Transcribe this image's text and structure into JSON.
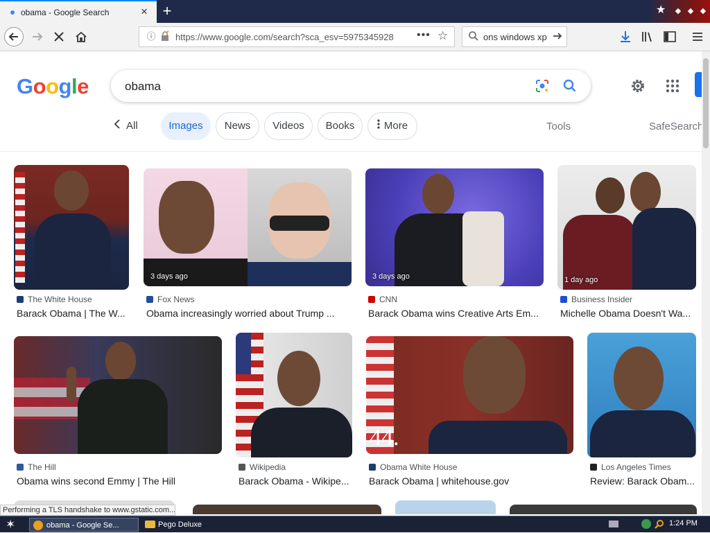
{
  "browser": {
    "tab": {
      "title": "obama - Google Search",
      "close_glyph": "×"
    },
    "new_tab_glyph": "+",
    "url": "https://www.google.com/search?sca_esv=5975345928",
    "url_menu_glyph": "•••",
    "searchbar": {
      "value": "ons windows xp"
    }
  },
  "google": {
    "logo": [
      "G",
      "o",
      "o",
      "g",
      "l",
      "e"
    ],
    "logo_colors": [
      "#4285f4",
      "#ea4335",
      "#fbbc05",
      "#4285f4",
      "#34a853",
      "#ea4335"
    ],
    "query": "obama",
    "chips": {
      "all": "All",
      "images": "Images",
      "news": "News",
      "videos": "Videos",
      "books": "Books",
      "more": "More"
    },
    "tools": "Tools",
    "safesearch": "SafeSearch"
  },
  "results": [
    {
      "source": "The White House",
      "title": "Barack Obama | The W...",
      "age": "",
      "src_color": "#1a3e74"
    },
    {
      "source": "Fox News",
      "title": "Obama increasingly worried about Trump ...",
      "age": "3 days ago",
      "src_color": "#1f4e9c"
    },
    {
      "source": "CNN",
      "title": "Barack Obama wins Creative Arts Em...",
      "age": "3 days ago",
      "src_color": "#cc0000"
    },
    {
      "source": "Business Insider",
      "title": "Michelle Obama Doesn't Wa...",
      "age": "1 day ago",
      "src_color": "#1c4fd8"
    },
    {
      "source": "The Hill",
      "title": "Obama wins second Emmy | The Hill",
      "age": "",
      "src_color": "#2c5aa0"
    },
    {
      "source": "Wikipedia",
      "title": "Barack Obama - Wikipe...",
      "age": "",
      "src_color": "#555555"
    },
    {
      "source": "Obama White House",
      "title": "Barack Obama | whitehouse.gov",
      "age": "",
      "overlay": "44.",
      "src_color": "#1a3e74"
    },
    {
      "source": "Los Angeles Times",
      "title": "Review: Barack Obam...",
      "age": "",
      "src_color": "#222222"
    }
  ],
  "status_text": "Performing a TLS handshake to www.gstatic.com...",
  "taskbar": {
    "tasks": [
      "obama - Google Se...",
      "Pego Deluxe"
    ],
    "clock": "1:24 PM"
  },
  "icons": [
    "back-icon",
    "forward-icon",
    "stop-icon",
    "home-icon",
    "info-icon",
    "lock-icon",
    "bookmark-star-icon",
    "search-icon",
    "arrow-right-icon",
    "download-icon",
    "library-icon",
    "sidebar-icon",
    "menu-icon",
    "lens-icon",
    "settings-icon",
    "apps-icon",
    "start-icon"
  ]
}
